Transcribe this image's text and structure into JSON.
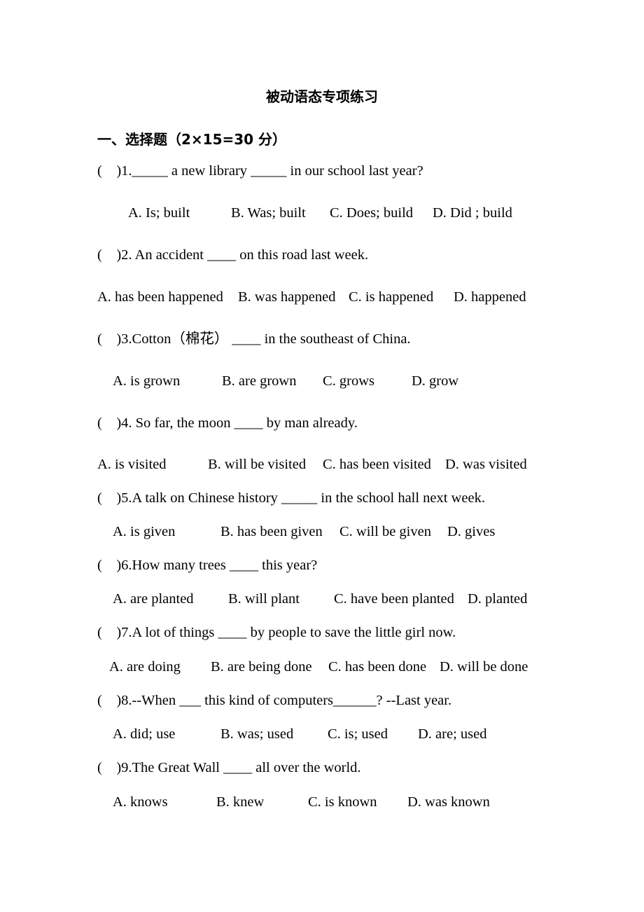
{
  "document": {
    "title": "被动语态专项练习",
    "section_heading": "一、选择题（2×15=30 分）",
    "questions": [
      {
        "number": "1",
        "stem": "( )1._____ a new library _____ in our school last year?",
        "options": [
          "A. Is; built",
          "B. Was; built",
          "C. Does; build",
          "D. Did ; build"
        ]
      },
      {
        "number": "2",
        "stem": "( )2. An accident ____ on this road last week.",
        "options": [
          "A. has been happened",
          "B. was happened",
          "C. is happened",
          "D. happened"
        ]
      },
      {
        "number": "3",
        "stem": "( )3.Cotton（棉花） ____ in the southeast of China.",
        "options": [
          "A. is grown",
          "B. are grown",
          "C. grows",
          "D. grow"
        ]
      },
      {
        "number": "4",
        "stem": "( )4. So far, the moon ____ by man already.",
        "options": [
          "A. is visited",
          "B. will be visited",
          "C. has been visited",
          "D. was visited"
        ]
      },
      {
        "number": "5",
        "stem": "( )5.A talk on Chinese history _____ in the school hall next week.",
        "options": [
          "A. is given",
          "B. has been given",
          "C. will be given",
          "D. gives"
        ]
      },
      {
        "number": "6",
        "stem": "( )6.How many trees ____ this year?",
        "options": [
          "A. are planted",
          "B. will plant",
          "C. have been planted",
          "D. planted"
        ]
      },
      {
        "number": "7",
        "stem": "( )7.A lot of things ____ by people to save the little girl now.",
        "options": [
          "A. are doing",
          "B. are being done",
          "C. has been done",
          "D. will be done"
        ]
      },
      {
        "number": "8",
        "stem": "( )8.--When ___ this kind of computers______? --Last year.",
        "options": [
          "A. did; use",
          "B. was; used",
          "C. is; used",
          "D. are; used"
        ]
      },
      {
        "number": "9",
        "stem": "( )9.The Great Wall ____ all over the world.",
        "options": [
          "A. knows",
          "B. knew",
          "C. is known",
          "D. was known"
        ]
      }
    ]
  }
}
